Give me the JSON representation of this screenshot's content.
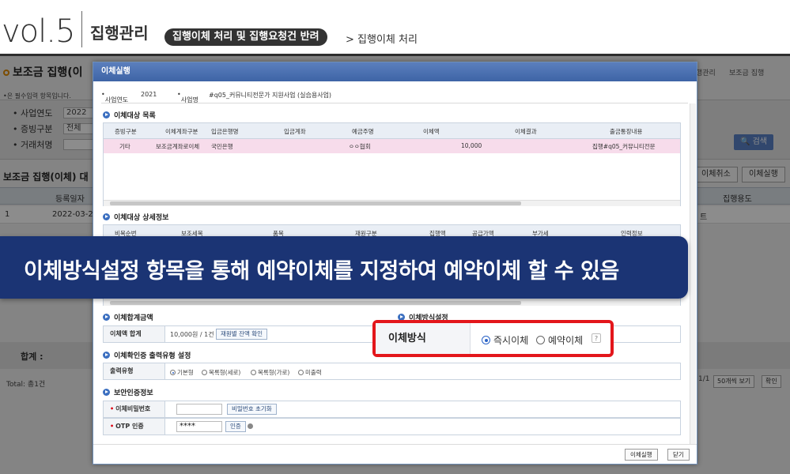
{
  "header": {
    "vol": "vol.5",
    "title": "집행관리",
    "pill": "집행이체 처리 및 집행요청건 반려",
    "crumb": "> 집행이체 처리"
  },
  "background": {
    "page_title": "보조금 집행(이",
    "required_note": "•은 필수입력 항목입니다.",
    "fields": [
      {
        "label": "• 사업연도",
        "value": "2022"
      },
      {
        "label": "• 증빙구분",
        "value": "전체"
      },
      {
        "label": "• 거래처명",
        "value": ""
      }
    ],
    "search_button": "검색",
    "grid_title": "보조금 집행(이체) 대",
    "buttons": [
      "이체취소",
      "이체실행"
    ],
    "grid_headers": [
      "등록일자",
      "집행용도"
    ],
    "grid_row": {
      "no": "1",
      "date": "2022-03-22",
      "tail": "트"
    },
    "sum_label": "합계 :",
    "total": "Total: 총1건",
    "pager": "1/1",
    "page_size": "50개씩 보기",
    "confirm": "확인",
    "nav": [
      "행관리",
      "보조금 집행"
    ]
  },
  "modal": {
    "title": "이체실행",
    "info": {
      "year_label": "사업연도",
      "year": "2021",
      "biz_label": "사업명",
      "biz": "#q05_커뮤니티전문가 지원사업 (실습용사업)"
    },
    "sec_list": "이체대상 목록",
    "list_headers": [
      "증빙구분",
      "이체계좌구분",
      "입금은행명",
      "입금계좌",
      "예금주명",
      "이체액",
      "이체결과",
      "출금통장내용"
    ],
    "list_row": [
      "기타",
      "보조금계좌로이체",
      "국민은행",
      "",
      "ㅇㅇ협회",
      "10,000",
      "",
      "집행#q05_커뮤니티전문"
    ],
    "sec_detail": "이체대상 상세정보",
    "detail_headers": [
      "비목순번",
      "보조세목",
      "품목",
      "재원구분",
      "집행액",
      "공급가액",
      "부가세",
      "인력정보"
    ],
    "sec_sum": "이체합계금액",
    "sum_label": "이체액 합계",
    "sum_value": "10,000원 / 1건",
    "sum_button": "재원별 잔액 확인",
    "sec_method": "이체방식설정",
    "sec_print": "이체확인증 출력유형 설정",
    "print_label": "출력유형",
    "print_options": [
      "기본형",
      "목록형(세로)",
      "목록형(가로)",
      "미출력"
    ],
    "sec_security": "보안인증정보",
    "pw_label": "이체비밀번호",
    "pw_button": "비밀번호 초기화",
    "otp_label": "OTP 인증",
    "otp_value": "****",
    "otp_button": "인증",
    "footer_buttons": [
      "이체실행",
      "닫기"
    ]
  },
  "highlight": {
    "label": "이체방식",
    "options": [
      "즉시이체",
      "예약이체"
    ],
    "selected": "즉시이체",
    "help": "?"
  },
  "banner": "이체방식설정 항목을 통해 예약이체를 지정하여 예약이체 할 수 있음",
  "colors": {
    "banner": "#1b3474",
    "highlight_border": "#e3161b",
    "modal_title": "#4a6fb2",
    "list_row": "#f7dceb"
  }
}
